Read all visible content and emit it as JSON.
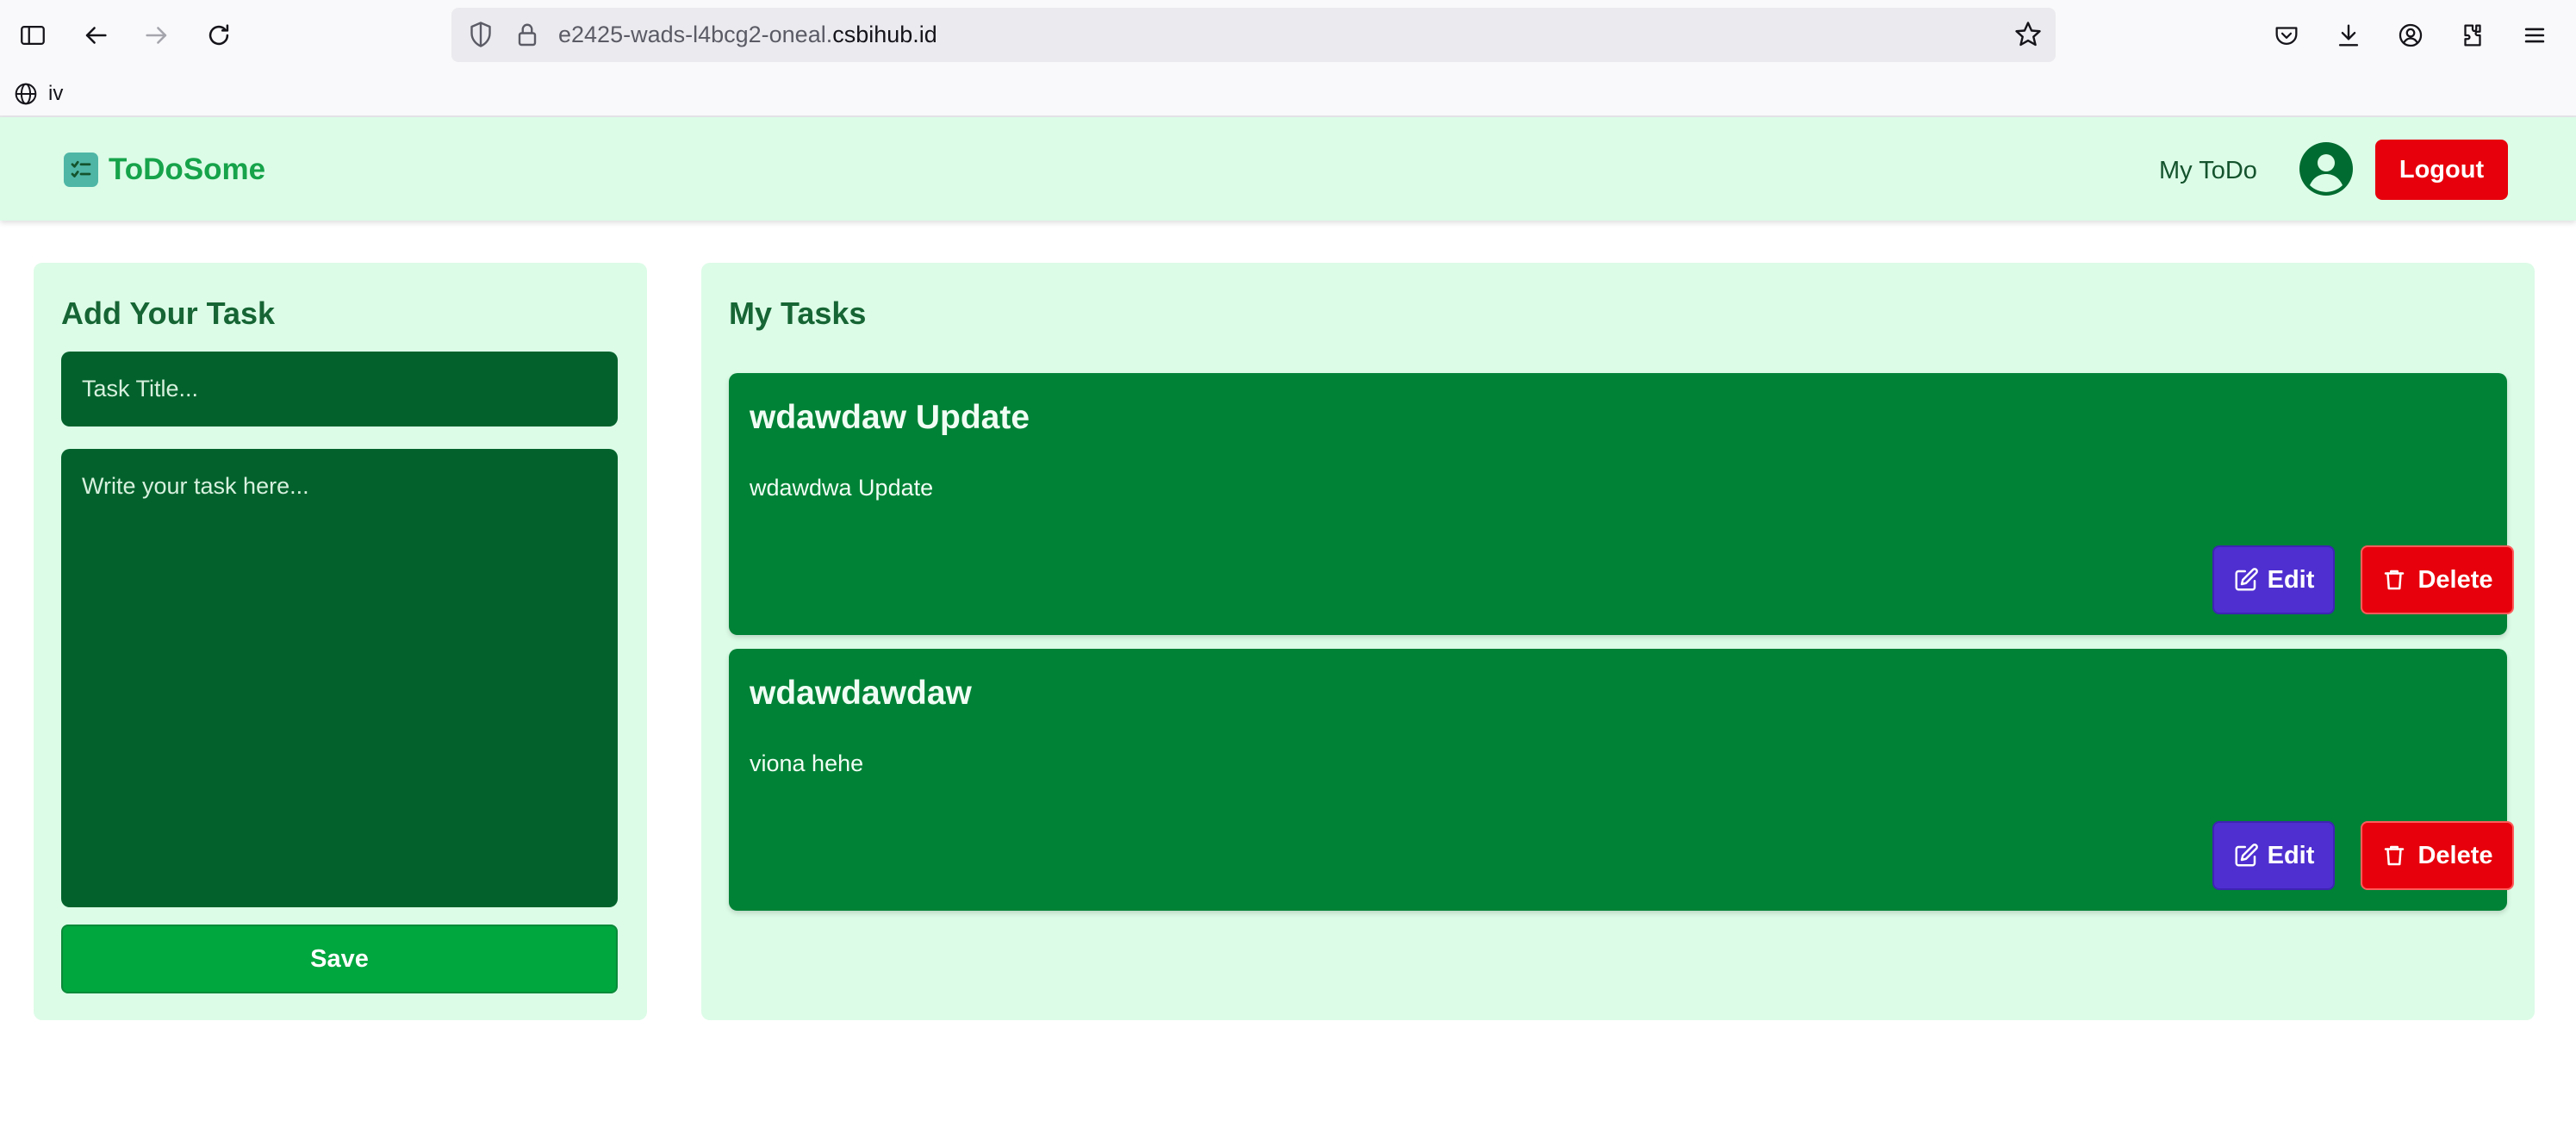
{
  "browser": {
    "url_prefix": "e2425-wads-l4bcg2-oneal.",
    "url_host": "csbihub.id",
    "bookmark_label": "iv"
  },
  "header": {
    "brand": "ToDoSome",
    "nav_link": "My ToDo",
    "logout_label": "Logout"
  },
  "add_task": {
    "title": "Add Your Task",
    "title_placeholder": "Task Title...",
    "body_placeholder": "Write your task here...",
    "save_label": "Save"
  },
  "my_tasks": {
    "title": "My Tasks",
    "tasks": [
      {
        "title": "wdawdaw Update",
        "description": "wdawdwa Update",
        "edit_label": "Edit",
        "delete_label": "Delete"
      },
      {
        "title": "wdawdawdaw",
        "description": "viona hehe",
        "edit_label": "Edit",
        "delete_label": "Delete"
      }
    ]
  },
  "colors": {
    "brand_green": "#16a34a",
    "header_bg": "#dcfce7",
    "card_green": "#008236",
    "input_green": "#03622c",
    "save_green": "#00a63e",
    "edit_indigo": "#4f2fd0",
    "danger_red": "#e7000b"
  },
  "icons": [
    "sidebar-icon",
    "back-icon",
    "forward-icon",
    "reload-icon",
    "shield-icon",
    "lock-icon",
    "star-icon",
    "pocket-icon",
    "download-icon",
    "account-icon",
    "extensions-icon",
    "menu-icon",
    "globe-icon",
    "checklist-icon",
    "user-avatar-icon",
    "edit-icon",
    "trash-icon"
  ]
}
